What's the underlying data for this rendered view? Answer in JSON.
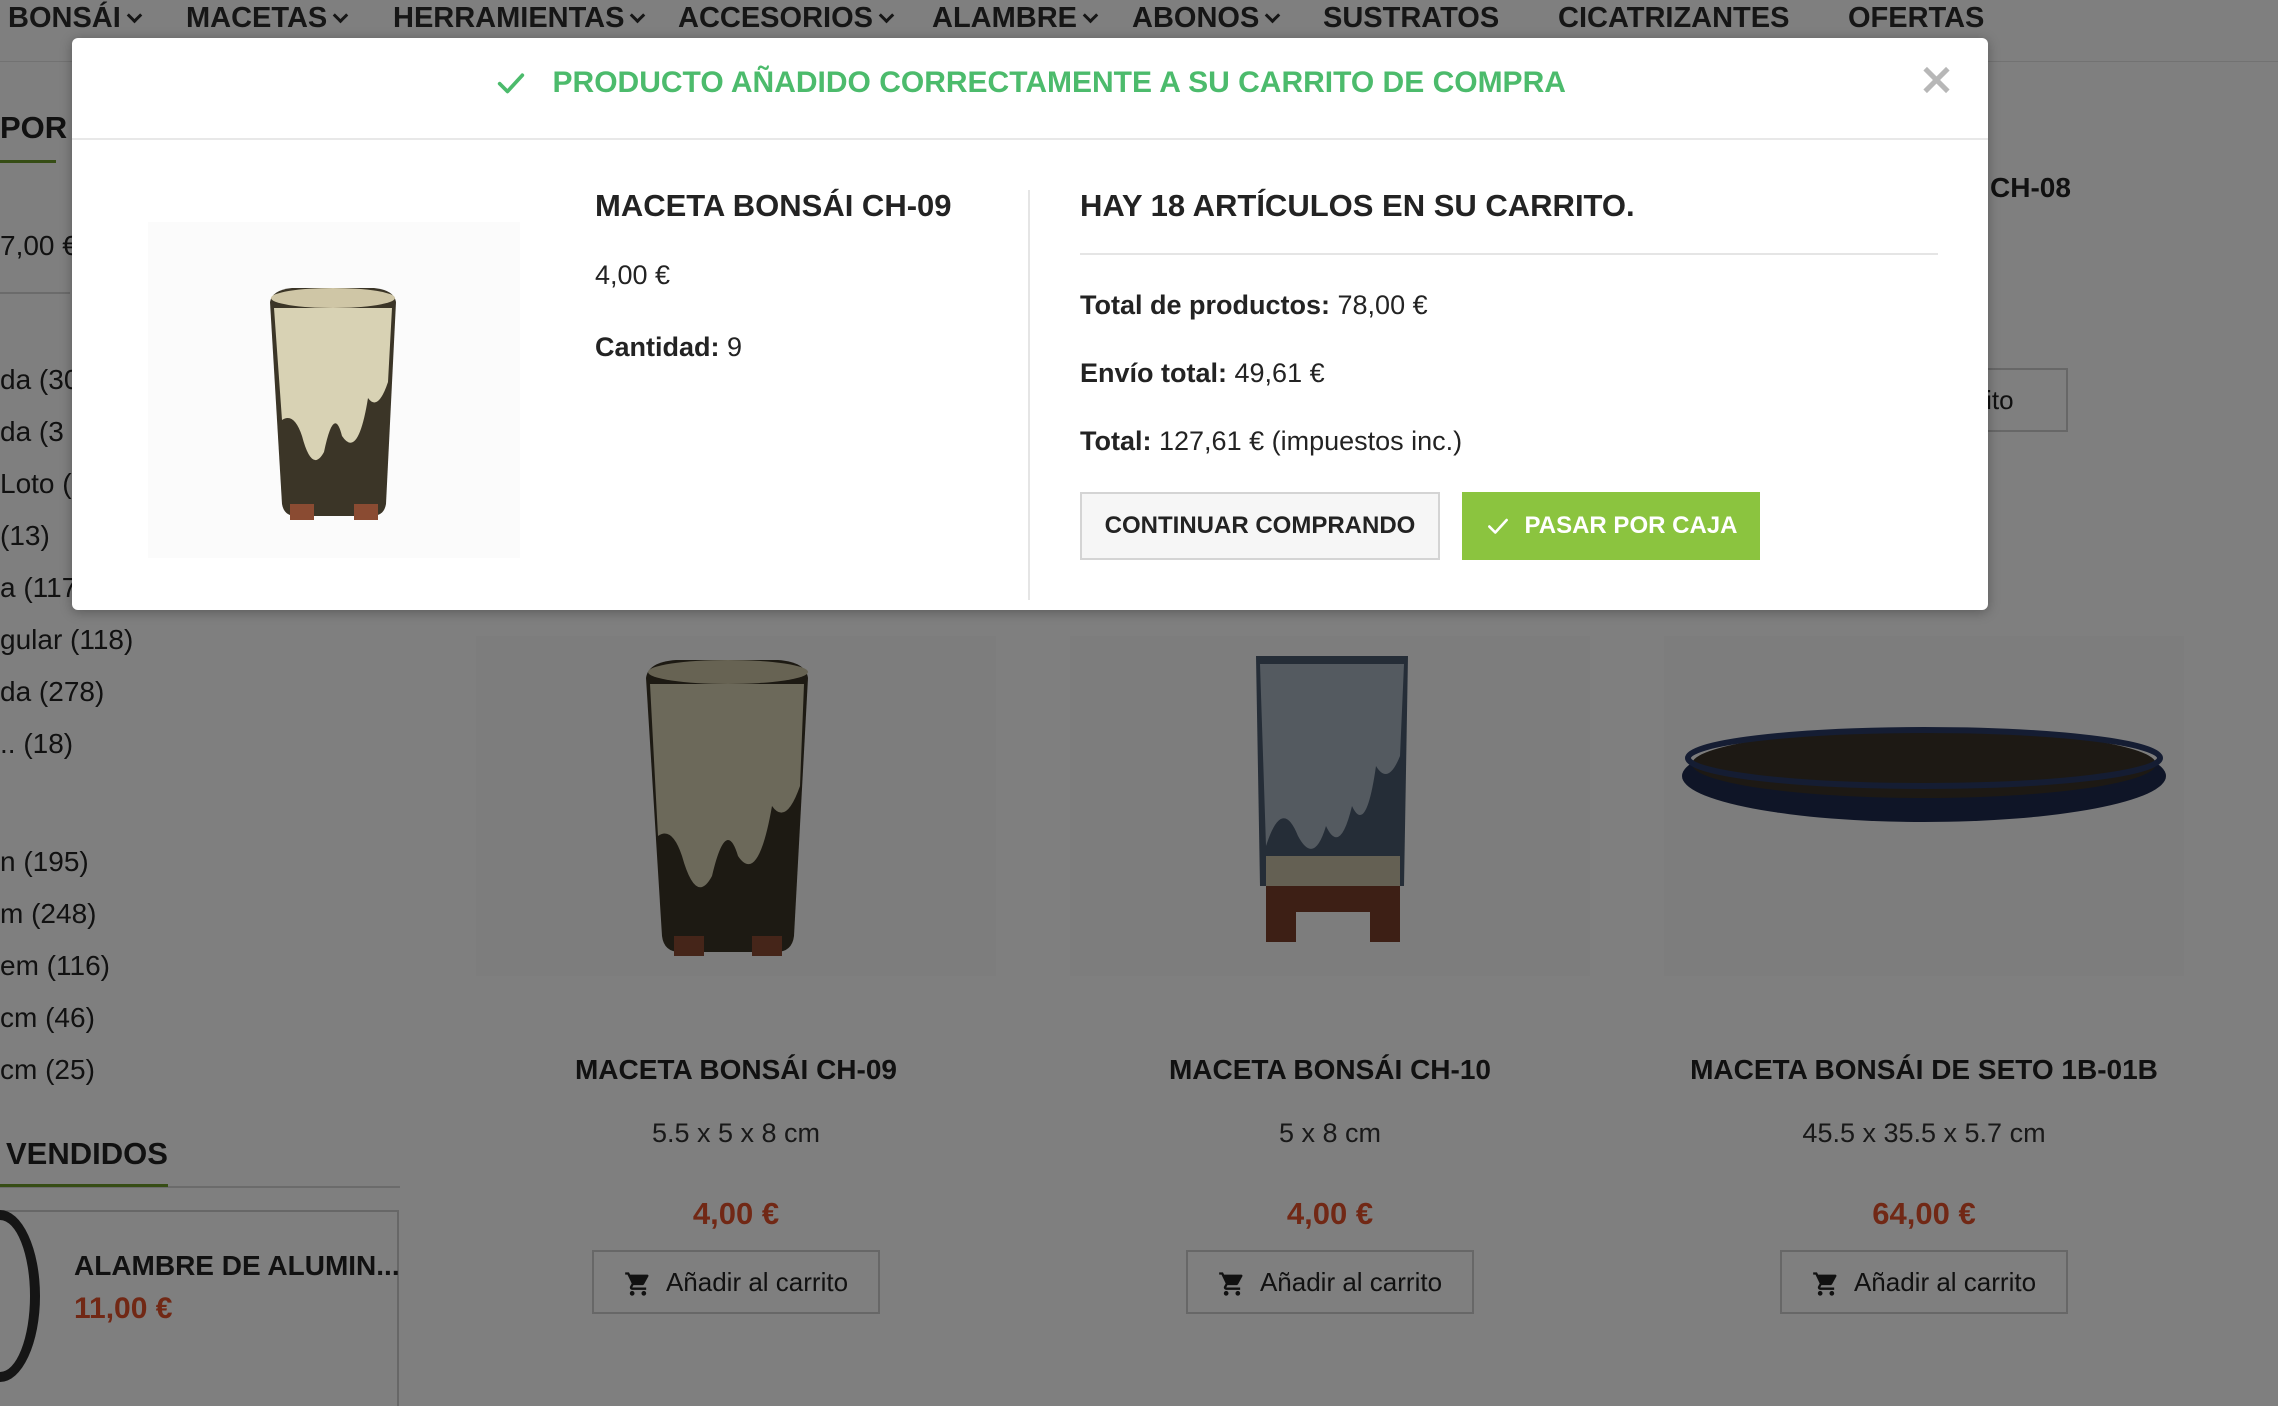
{
  "nav": {
    "items": [
      {
        "label": "BONSÁI",
        "has_dropdown": true
      },
      {
        "label": "MACETAS",
        "has_dropdown": true
      },
      {
        "label": "HERRAMIENTAS",
        "has_dropdown": true
      },
      {
        "label": "ACCESORIOS",
        "has_dropdown": true
      },
      {
        "label": "ALAMBRE",
        "has_dropdown": true
      },
      {
        "label": "ABONOS",
        "has_dropdown": true
      },
      {
        "label": "SUSTRATOS",
        "has_dropdown": false
      },
      {
        "label": "CICATRIZANTES",
        "has_dropdown": false
      },
      {
        "label": "OFERTAS",
        "has_dropdown": false
      }
    ]
  },
  "sidebar": {
    "heading": "POR",
    "price_value": "7,00 €",
    "filters_shape": [
      "da (30",
      "da (3",
      "Loto (",
      "(13)",
      "a (117)",
      "gular (118)",
      "da (278)",
      ".. (18)"
    ],
    "filters_size": [
      "n (195)",
      "m (248)",
      "em (116)",
      "cm (46)",
      "cm (25)"
    ],
    "bestsellers_heading": "VENDIDOS",
    "bestseller": {
      "name": "ALAMBRE DE ALUMIN...",
      "price": "11,00 €"
    }
  },
  "products": [
    {
      "name": "MACETA BONSÁI CH-09",
      "size": "5.5 x 5 x 8 cm",
      "price": "4,00 €",
      "button": "Añadir al carrito"
    },
    {
      "name": "MACETA BONSÁI CH-10",
      "size": "5 x 8 cm",
      "price": "4,00 €",
      "button": "Añadir al carrito"
    },
    {
      "name": "MACETA BONSÁI DE SETO 1B-01B",
      "size": "45.5 x 35.5 x 5.7 cm",
      "price": "64,00 €",
      "button": "Añadir al carrito"
    }
  ],
  "background_partial": {
    "top_right_name": "CH-08",
    "top_right_button": "arrito"
  },
  "modal": {
    "title": "PRODUCTO AÑADIDO CORRECTAMENTE A SU CARRITO DE COMPRA",
    "product_name": "MACETA BONSÁI CH-09",
    "product_price": "4,00 €",
    "quantity_label": "Cantidad:",
    "quantity_value": "9",
    "cart_count_text": "HAY 18 ARTÍCULOS EN SU CARRITO.",
    "total_products_label": "Total de productos:",
    "total_products_value": "78,00 €",
    "shipping_label": "Envío total:",
    "shipping_value": "49,61 €",
    "total_label": "Total:",
    "total_value": "127,61 € (impuestos inc.)",
    "continue_button": "CONTINUAR COMPRANDO",
    "checkout_button": "PASAR POR CAJA"
  },
  "colors": {
    "success_green": "#4cbb6c",
    "checkout_green": "#8bc43f",
    "price_red": "#e2512b",
    "accent_underline": "#6c9b2b"
  }
}
